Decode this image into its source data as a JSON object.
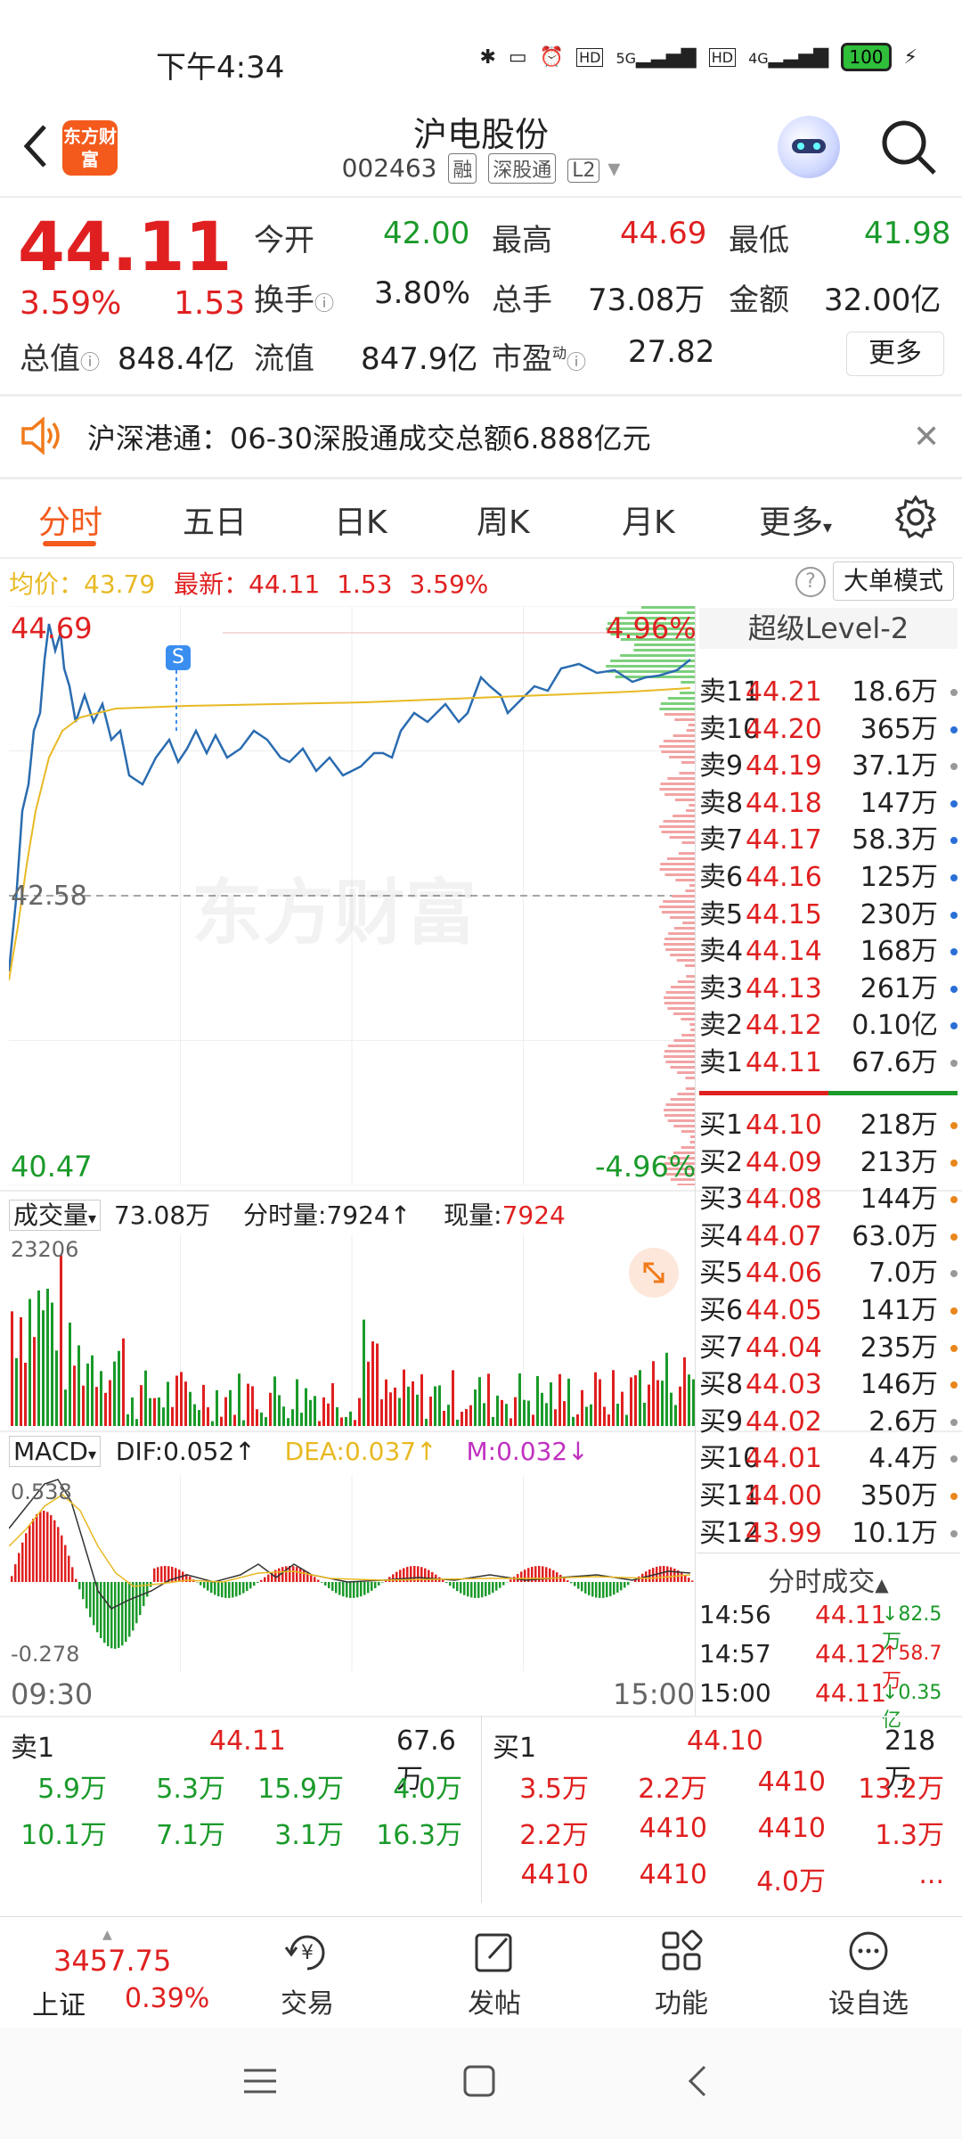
{
  "status_bar": {
    "time": "下午4:34",
    "battery": "100",
    "net1": "5G",
    "net2": "4G"
  },
  "header": {
    "logo_text": "东方财富",
    "stock_name": "沪电股份",
    "stock_code": "002463",
    "tags": [
      "融",
      "深股通",
      "L2"
    ]
  },
  "quote": {
    "price": "44.11",
    "change_pct": "3.59%",
    "change_amt": "1.53",
    "open_label": "今开",
    "open": "42.00",
    "high_label": "最高",
    "high": "44.69",
    "low_label": "最低",
    "low": "41.98",
    "turnover_label": "换手",
    "turnover": "3.80%",
    "volume_label": "总手",
    "volume": "73.08万",
    "amount_label": "金额",
    "amount": "32.00亿",
    "mktcap_label": "总值",
    "mktcap": "848.4亿",
    "float_label": "流值",
    "float": "847.9亿",
    "pe_label": "市盈",
    "pe_sup": "动",
    "pe": "27.82",
    "more": "更多"
  },
  "notice": {
    "text": "沪深港通：06-30深股通成交总额6.888亿元"
  },
  "tabs": [
    "分时",
    "五日",
    "日K",
    "周K",
    "月K",
    "更多"
  ],
  "info_line": {
    "avg_label": "均价：",
    "avg": "43.79",
    "latest_label": "最新：",
    "latest": "44.11",
    "chg": "1.53",
    "pct": "3.59%",
    "mode_btn": "大单模式"
  },
  "chart_labels": {
    "high_price": "44.69",
    "high_pct": "4.96%",
    "mid_price": "42.58",
    "low_price": "40.47",
    "low_pct": "-4.96%",
    "watermark": "东方财富",
    "s_marker": "S"
  },
  "volume_bar": {
    "label": "成交量",
    "total": "73.08万",
    "tick_label": "分时量:",
    "tick": "7924",
    "now_label": "现量:",
    "now": "7924",
    "max": "23206"
  },
  "macd": {
    "label": "MACD",
    "dif": "DIF:0.052",
    "dea": "DEA:0.037",
    "m": "M:0.032",
    "top": "0.538",
    "bottom": "-0.278"
  },
  "time_axis": {
    "start": "09:30",
    "end": "15:00"
  },
  "level2": {
    "title": "超级Level-2"
  },
  "sell_book": [
    {
      "label": "卖11",
      "price": "44.21",
      "vol": "18.6万",
      "dot": "#999"
    },
    {
      "label": "卖10",
      "price": "44.20",
      "vol": "365万",
      "dot": "#2a6fd6"
    },
    {
      "label": "卖9",
      "price": "44.19",
      "vol": "37.1万",
      "dot": "#999"
    },
    {
      "label": "卖8",
      "price": "44.18",
      "vol": "147万",
      "dot": "#2a6fd6"
    },
    {
      "label": "卖7",
      "price": "44.17",
      "vol": "58.3万",
      "dot": "#2a6fd6"
    },
    {
      "label": "卖6",
      "price": "44.16",
      "vol": "125万",
      "dot": "#2a6fd6"
    },
    {
      "label": "卖5",
      "price": "44.15",
      "vol": "230万",
      "dot": "#2a6fd6"
    },
    {
      "label": "卖4",
      "price": "44.14",
      "vol": "168万",
      "dot": "#2a6fd6"
    },
    {
      "label": "卖3",
      "price": "44.13",
      "vol": "261万",
      "dot": "#2a6fd6"
    },
    {
      "label": "卖2",
      "price": "44.12",
      "vol": "0.10亿",
      "dot": "#2a6fd6"
    },
    {
      "label": "卖1",
      "price": "44.11",
      "vol": "67.6万",
      "dot": "#999"
    }
  ],
  "buy_book": [
    {
      "label": "买1",
      "price": "44.10",
      "vol": "218万",
      "dot": "#e8861b"
    },
    {
      "label": "买2",
      "price": "44.09",
      "vol": "213万",
      "dot": "#e8861b"
    },
    {
      "label": "买3",
      "price": "44.08",
      "vol": "144万",
      "dot": "#e8861b"
    },
    {
      "label": "买4",
      "price": "44.07",
      "vol": "63.0万",
      "dot": "#e8861b"
    },
    {
      "label": "买5",
      "price": "44.06",
      "vol": "7.0万",
      "dot": "#999"
    },
    {
      "label": "买6",
      "price": "44.05",
      "vol": "141万",
      "dot": "#e8861b"
    },
    {
      "label": "买7",
      "price": "44.04",
      "vol": "235万",
      "dot": "#e8861b"
    },
    {
      "label": "买8",
      "price": "44.03",
      "vol": "146万",
      "dot": "#e8861b"
    },
    {
      "label": "买9",
      "price": "44.02",
      "vol": "2.6万",
      "dot": "#999"
    },
    {
      "label": "买10",
      "price": "44.01",
      "vol": "4.4万",
      "dot": "#999"
    },
    {
      "label": "买11",
      "price": "44.00",
      "vol": "350万",
      "dot": "#e8861b"
    },
    {
      "label": "买12",
      "price": "43.99",
      "vol": "10.1万",
      "dot": "#999"
    }
  ],
  "trades": {
    "title": "分时成交",
    "rows": [
      {
        "time": "14:56",
        "price": "44.11",
        "dir": "↓",
        "vol": "82.5万",
        "color": "green"
      },
      {
        "time": "14:57",
        "price": "44.12",
        "dir": "↑",
        "vol": "58.7万",
        "color": "red"
      },
      {
        "time": "15:00",
        "price": "44.11",
        "dir": "↓",
        "vol": "0.35亿",
        "color": "green"
      }
    ]
  },
  "queue": {
    "sell_label": "卖1",
    "sell_price": "44.11",
    "sell_vol": "67.6万",
    "buy_label": "买1",
    "buy_price": "44.10",
    "buy_vol": "218万",
    "sell_items": [
      "5.9万",
      "5.3万",
      "15.9万",
      "4.0万",
      "10.1万",
      "7.1万",
      "3.1万",
      "16.3万"
    ],
    "buy_items": [
      "3.5万",
      "2.2万",
      "4410",
      "13.2万",
      "2.2万",
      "4410",
      "4410",
      "1.3万",
      "4410",
      "4410",
      "4.0万",
      "..."
    ]
  },
  "bottom_nav": {
    "index_value": "3457.75",
    "index_name": "上证",
    "index_pct": "0.39%",
    "items": [
      "交易",
      "发帖",
      "功能",
      "设自选"
    ]
  },
  "colors": {
    "up": "#e02020",
    "down": "#1a9a2a",
    "accent": "#f35a1c",
    "price_line": "#2a6cb0",
    "avg_line": "#e8b923"
  }
}
